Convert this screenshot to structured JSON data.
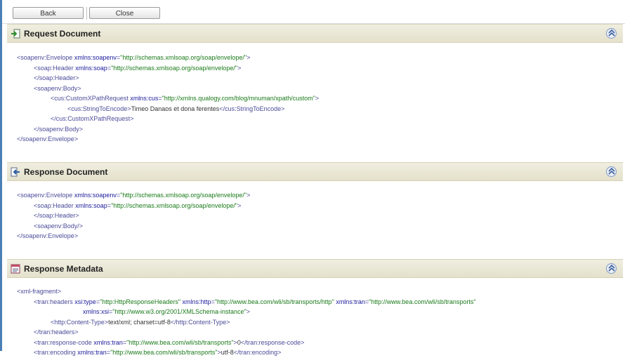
{
  "toolbar": {
    "back_label": "Back",
    "close_label": "Close"
  },
  "sections": {
    "request": {
      "title": "Request Document",
      "lines": [
        {
          "i": 0,
          "parts": [
            [
              "t",
              "<soapenv:Envelope "
            ],
            [
              "a",
              "xmlns:soapenv"
            ],
            [
              "t",
              "="
            ],
            [
              "v",
              "\"http://schemas.xmlsoap.org/soap/envelope/\""
            ],
            [
              "t",
              ">"
            ]
          ]
        },
        {
          "i": 1,
          "parts": [
            [
              "t",
              "<soap:Header "
            ],
            [
              "a",
              "xmlns:soap"
            ],
            [
              "t",
              "="
            ],
            [
              "v",
              "\"http://schemas.xmlsoap.org/soap/envelope/\""
            ],
            [
              "t",
              ">"
            ]
          ]
        },
        {
          "i": 1,
          "parts": [
            [
              "t",
              "</soap:Header>"
            ]
          ]
        },
        {
          "i": 1,
          "parts": [
            [
              "t",
              "<soapenv:Body>"
            ]
          ]
        },
        {
          "i": 2,
          "parts": [
            [
              "t",
              "<cus:CustomXPathRequest "
            ],
            [
              "a",
              "xmlns:cus"
            ],
            [
              "t",
              "="
            ],
            [
              "v",
              "\"http://xmlns.qualogy.com/blog/mnuman/xpath/custom\""
            ],
            [
              "t",
              ">"
            ]
          ]
        },
        {
          "i": 3,
          "parts": [
            [
              "t",
              "<cus:StringToEncode>"
            ],
            [
              "x",
              "Timeo Danaos et dona ferentes"
            ],
            [
              "t",
              "</cus:StringToEncode>"
            ]
          ]
        },
        {
          "i": 2,
          "parts": [
            [
              "t",
              "</cus:CustomXPathRequest>"
            ]
          ]
        },
        {
          "i": 1,
          "parts": [
            [
              "t",
              "</soapenv:Body>"
            ]
          ]
        },
        {
          "i": 0,
          "parts": [
            [
              "t",
              "</soapenv:Envelope>"
            ]
          ]
        }
      ]
    },
    "response": {
      "title": "Response Document",
      "lines": [
        {
          "i": 0,
          "parts": [
            [
              "t",
              "<soapenv:Envelope "
            ],
            [
              "a",
              "xmlns:soapenv"
            ],
            [
              "t",
              "="
            ],
            [
              "v",
              "\"http://schemas.xmlsoap.org/soap/envelope/\""
            ],
            [
              "t",
              ">"
            ]
          ]
        },
        {
          "i": 1,
          "parts": [
            [
              "t",
              "<soap:Header "
            ],
            [
              "a",
              "xmlns:soap"
            ],
            [
              "t",
              "="
            ],
            [
              "v",
              "\"http://schemas.xmlsoap.org/soap/envelope/\""
            ],
            [
              "t",
              ">"
            ]
          ]
        },
        {
          "i": 1,
          "parts": [
            [
              "t",
              "</soap:Header>"
            ]
          ]
        },
        {
          "i": 1,
          "parts": [
            [
              "t",
              "<soapenv:Body/>"
            ]
          ]
        },
        {
          "i": 0,
          "parts": [
            [
              "t",
              "</soapenv:Envelope>"
            ]
          ]
        }
      ]
    },
    "metadata": {
      "title": "Response Metadata",
      "lines": [
        {
          "i": 0,
          "parts": [
            [
              "t",
              "<xml-fragment>"
            ]
          ]
        },
        {
          "i": 1,
          "parts": [
            [
              "t",
              "<tran:headers "
            ],
            [
              "a",
              "xsi:type"
            ],
            [
              "t",
              "="
            ],
            [
              "v",
              "\"http:HttpResponseHeaders\""
            ],
            [
              "t",
              " "
            ],
            [
              "a",
              "xmlns:http"
            ],
            [
              "t",
              "="
            ],
            [
              "v",
              "\"http://www.bea.com/wli/sb/transports/http\""
            ],
            [
              "t",
              " "
            ],
            [
              "a",
              "xmlns:tran"
            ],
            [
              "t",
              "="
            ],
            [
              "v",
              "\"http://www.bea.com/wli/sb/transports\""
            ]
          ]
        },
        {
          "i": 4,
          "parts": [
            [
              "a",
              "xmlns:xsi"
            ],
            [
              "t",
              "="
            ],
            [
              "v",
              "\"http://www.w3.org/2001/XMLSchema-instance\""
            ],
            [
              "t",
              ">"
            ]
          ]
        },
        {
          "i": 2,
          "parts": [
            [
              "t",
              "<http:Content-Type>"
            ],
            [
              "x",
              "text/xml; charset=utf-8"
            ],
            [
              "t",
              "</http:Content-Type>"
            ]
          ]
        },
        {
          "i": 1,
          "parts": [
            [
              "t",
              "</tran:headers>"
            ]
          ]
        },
        {
          "i": 1,
          "parts": [
            [
              "t",
              "<tran:response-code "
            ],
            [
              "a",
              "xmlns:tran"
            ],
            [
              "t",
              "="
            ],
            [
              "v",
              "\"http://www.bea.com/wli/sb/transports\""
            ],
            [
              "t",
              ">"
            ],
            [
              "x",
              "0"
            ],
            [
              "t",
              "</tran:response-code>"
            ]
          ]
        },
        {
          "i": 1,
          "parts": [
            [
              "t",
              "<tran:encoding "
            ],
            [
              "a",
              "xmlns:tran"
            ],
            [
              "t",
              "="
            ],
            [
              "v",
              "\"http://www.bea.com/wli/sb/transports\""
            ],
            [
              "t",
              ">"
            ],
            [
              "x",
              "utf-8"
            ],
            [
              "t",
              "</tran:encoding>"
            ]
          ]
        }
      ]
    }
  },
  "colors": {
    "header_bg": "#e8e5d0",
    "tag": "#4b4b9a",
    "attr": "#1a1a9c",
    "value": "#1a7a1a",
    "left_bar": "#4a7fb5"
  },
  "icons": {
    "request": "arrow-in-icon",
    "response": "arrow-out-icon",
    "metadata": "document-list-icon",
    "collapse": "double-chevron-up-icon"
  }
}
